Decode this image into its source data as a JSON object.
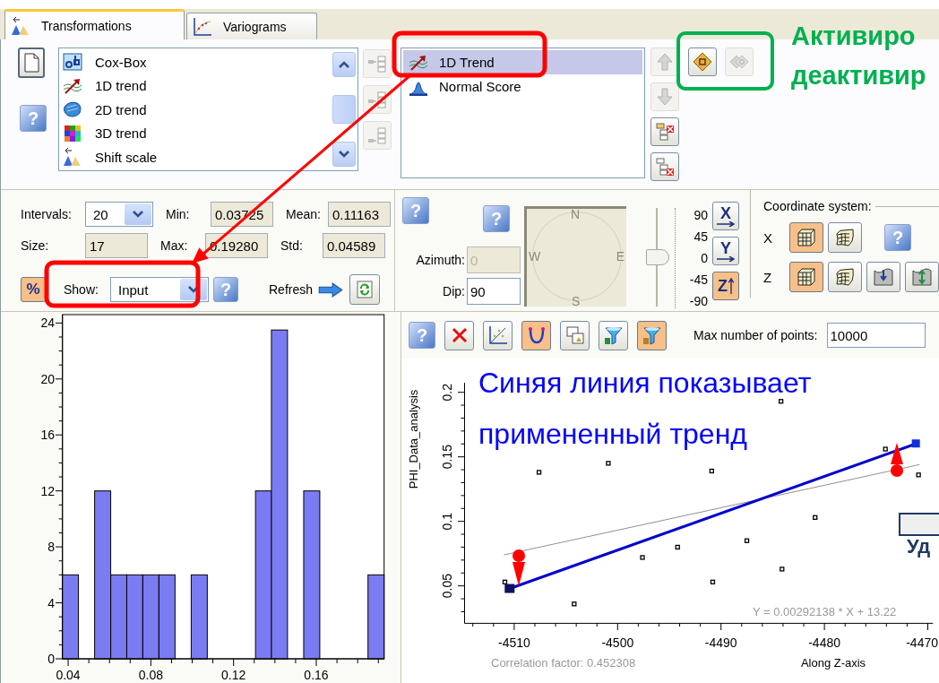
{
  "tabs": [
    {
      "label": "Transformations",
      "kind": "transform",
      "selected": true
    },
    {
      "label": "Variograms",
      "kind": "variogram",
      "selected": false
    }
  ],
  "transform_tools": {
    "help_label": "?"
  },
  "available_transforms": [
    {
      "label": "Cox-Box",
      "kind": "coxbox",
      "selected": false
    },
    {
      "label": "1D trend",
      "kind": "trend1d",
      "selected": false
    },
    {
      "label": "2D trend",
      "kind": "trend2d",
      "selected": false
    },
    {
      "label": "3D trend",
      "kind": "trend3d",
      "selected": false
    },
    {
      "label": "Shift scale",
      "kind": "shift",
      "selected": false
    }
  ],
  "insert_buttons": [
    {
      "kind": "first",
      "disabled": true
    },
    {
      "kind": "middle",
      "disabled": true
    },
    {
      "kind": "last",
      "disabled": true
    }
  ],
  "applied_transforms": [
    {
      "label": "1D Trend",
      "kind": "trend1d",
      "selected": true
    },
    {
      "label": "Normal Score",
      "kind": "normal",
      "selected": false
    }
  ],
  "order_buttons": [
    {
      "kind": "up",
      "disabled": true
    },
    {
      "kind": "down",
      "disabled": true
    },
    {
      "kind": "remove",
      "disabled": false
    },
    {
      "kind": "clear",
      "disabled": false
    }
  ],
  "activation_buttons": [
    {
      "kind": "activate",
      "disabled": false
    },
    {
      "kind": "deactivate",
      "disabled": true
    }
  ],
  "green_note": [
    "Активиро",
    "деактивир"
  ],
  "statistics": {
    "intervals_label": "Intervals:",
    "intervals": "20",
    "min_label": "Min:",
    "min": "0.03725",
    "mean_label": "Mean:",
    "mean": "0.11163",
    "size_label": "Size:",
    "size": "17",
    "max_label": "Max:",
    "max": "0.19280",
    "std_label": "Std:",
    "std": "0.04589"
  },
  "display": {
    "percent_label": "%",
    "percent_on": true,
    "show_label": "Show:",
    "show_value": "Input",
    "help_label": "?",
    "refresh_label": "Refresh"
  },
  "histogram": {
    "chart_data": {
      "type": "bar",
      "x": [
        0.0411,
        0.0489,
        0.0567,
        0.0645,
        0.0722,
        0.08,
        0.0878,
        0.0956,
        0.1034,
        0.1111,
        0.1189,
        0.1267,
        0.1345,
        0.1422,
        0.15,
        0.1578,
        0.1656,
        0.1734,
        0.1811,
        0.1889
      ],
      "series": [
        {
          "color": "#7b7bf2",
          "values": [
            6,
            0,
            12,
            6,
            6,
            6,
            6,
            0,
            6,
            0,
            0,
            0,
            12,
            23.5,
            0,
            12,
            0,
            0,
            0,
            6
          ]
        }
      ],
      "xlim": [
        0.03725,
        0.1928
      ],
      "ylim": [
        0,
        24.6
      ],
      "xticks": [
        0.04,
        0.08,
        0.12,
        0.16
      ],
      "yticks": [
        0,
        4,
        8,
        12,
        16,
        20,
        24
      ]
    }
  },
  "orientation": {
    "help_labels": [
      "?",
      "?"
    ],
    "azimuth_label": "Azimuth:",
    "azimuth": "0",
    "azimuth_disabled": true,
    "dip_label": "Dip:",
    "dip": "90",
    "compass": [
      "N",
      "E",
      "S",
      "W"
    ],
    "dip_scale": [
      "90",
      "45",
      "0",
      "-45",
      "-90"
    ],
    "dip_slider": {
      "level": 0.5
    },
    "axis_buttons": [
      {
        "label": "X",
        "kind": "right",
        "selected": false
      },
      {
        "label": "Y",
        "kind": "right",
        "selected": false
      },
      {
        "label": "Z",
        "kind": "up",
        "selected": true
      }
    ]
  },
  "coordinate_system": {
    "label": "Coordinate system:",
    "help_label": "?",
    "rows": [
      {
        "axis": "X",
        "buttons": [
          {
            "kind": "grid",
            "selected": true
          },
          {
            "kind": "warped",
            "selected": false
          }
        ]
      },
      {
        "axis": "Z",
        "buttons": [
          {
            "kind": "grid",
            "selected": true
          },
          {
            "kind": "warped",
            "selected": false
          },
          {
            "kind": "flatten",
            "selected": false
          },
          {
            "kind": "unflatten",
            "selected": false
          }
        ]
      }
    ]
  },
  "scatter_toolbar": {
    "help_label": "?",
    "tools": [
      {
        "kind": "delete",
        "selected": false
      },
      {
        "kind": "scatter",
        "selected": false
      },
      {
        "kind": "curve",
        "selected": true
      },
      {
        "kind": "windows",
        "selected": false
      },
      {
        "kind": "nfilter",
        "selected": false
      },
      {
        "kind": "rfilter",
        "selected": true
      }
    ],
    "max_points_label": "Max number of points:",
    "max_points": "10000"
  },
  "scatter": {
    "chart_data": {
      "type": "scatter",
      "xlabel": "Along Z-axis",
      "ylabel": "PHI_Data_analysis",
      "xlim": [
        -4514.8,
        -4469.5
      ],
      "ylim": [
        0.021,
        0.207
      ],
      "xticks": [
        -4510,
        -4500,
        -4490,
        -4480,
        -4470
      ],
      "yticks": [
        0.05,
        0.1,
        0.15,
        0.2
      ],
      "x": [
        -4511,
        -4510.9,
        -4510.4,
        -4507.6,
        -4504.2,
        -4500.9,
        -4497.6,
        -4494.2,
        -4490.9,
        -4490.8,
        -4487.5,
        -4484.2,
        -4484.1,
        -4480.9,
        -4474.1,
        -4471.2,
        -4470.9,
        -4470.8
      ],
      "series": [
        {
          "color": "#000000",
          "values": [
            null,
            0.053,
            null,
            0.138,
            0.036,
            0.145,
            0.072,
            0.08,
            0.139,
            0.053,
            0.085,
            0.193,
            0.063,
            0.103,
            0.156,
            null,
            0.136,
            null
          ]
        },
        {
          "type": "line",
          "color": "#909090",
          "values": [
            0.074,
            null,
            null,
            null,
            null,
            null,
            null,
            null,
            null,
            null,
            null,
            null,
            null,
            null,
            null,
            null,
            null,
            0.144
          ]
        },
        {
          "type": "line",
          "marker": true,
          "color": "#0000cc",
          "values": [
            null,
            null,
            0.048,
            null,
            null,
            null,
            null,
            null,
            null,
            null,
            null,
            null,
            null,
            null,
            null,
            0.16,
            null,
            null
          ]
        }
      ]
    },
    "equation": "Y = 0.00292138 * X + 13.22",
    "correlation": "Correlation factor: 0.452308",
    "note": [
      "Синяя линия показывает",
      "примененный тренд"
    ],
    "cut_label": "Уд"
  }
}
